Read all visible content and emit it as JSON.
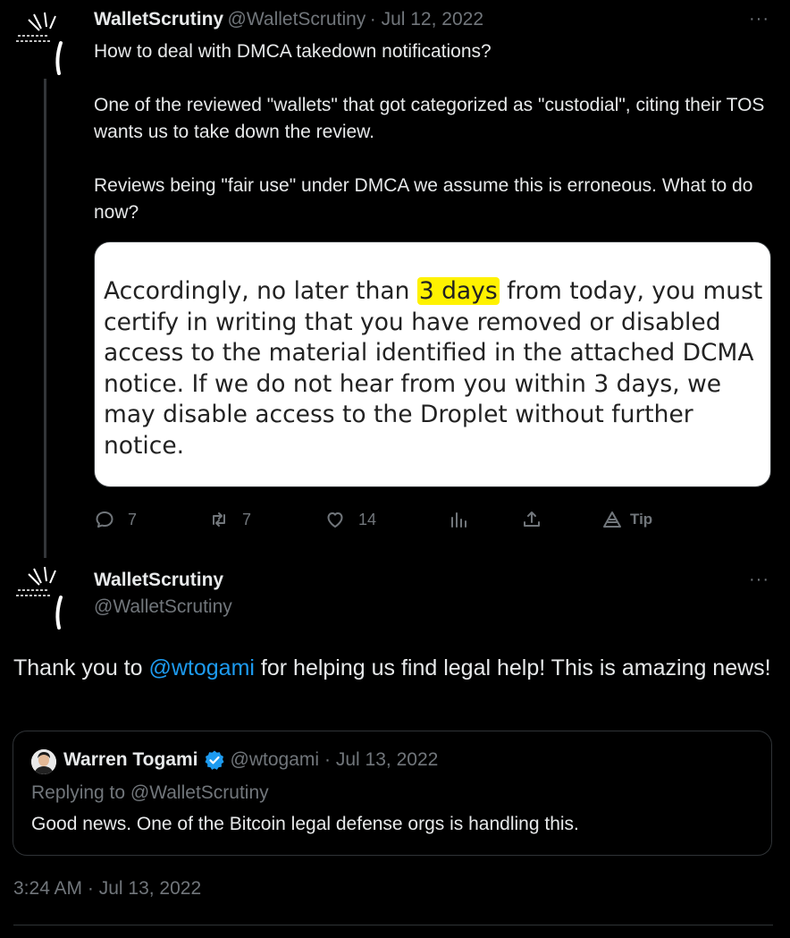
{
  "parent_tweet": {
    "display_name": "WalletScrutiny",
    "handle": "@WalletScrutiny",
    "date": "· Jul 12, 2022",
    "more": "···",
    "paragraphs": [
      "How to deal with DMCA takedown notifications?",
      "One of the reviewed \"wallets\" that got categorized as \"custodial\", citing their TOS wants us to take down the review.",
      "Reviews being \"fair use\" under DMCA we assume this is erroneous. What to do now?"
    ],
    "media": {
      "before_highlight": "Accordingly, no later than ",
      "highlight": "3 days",
      "after_highlight": " from today, you must certify in writing that you have removed or disabled access to the material identified in the attached DCMA notice. If we do not hear from you within 3 days, we may disable access to the Droplet without further notice.",
      "highlight_color": "#fff200"
    },
    "actions": {
      "reply_icon": "reply-icon",
      "reply_count": "7",
      "retweet_icon": "retweet-icon",
      "retweet_count": "7",
      "like_icon": "like-icon",
      "like_count": "14",
      "views_icon": "views-icon",
      "share_icon": "share-icon",
      "tip_icon": "tip-icon",
      "tip_label": "Tip"
    }
  },
  "main_tweet": {
    "display_name": "WalletScrutiny",
    "handle": "@WalletScrutiny",
    "more": "···",
    "text_before": "Thank you to ",
    "mention": "@wtogami",
    "text_after": " for helping us find legal help! This is amazing news!",
    "quote": {
      "display_name": "Warren Togami",
      "handle": "@wtogami",
      "date": "· Jul 13, 2022",
      "replying_to": "Replying to @WalletScrutiny",
      "text": "Good news. One of the Bitcoin legal defense orgs is handling this."
    },
    "timestamp": "3:24 AM · Jul 13, 2022"
  },
  "colors": {
    "background": "#000000",
    "text": "#e7e9ea",
    "muted": "#71767b",
    "link": "#1d9bf0",
    "border": "#2f3336"
  }
}
